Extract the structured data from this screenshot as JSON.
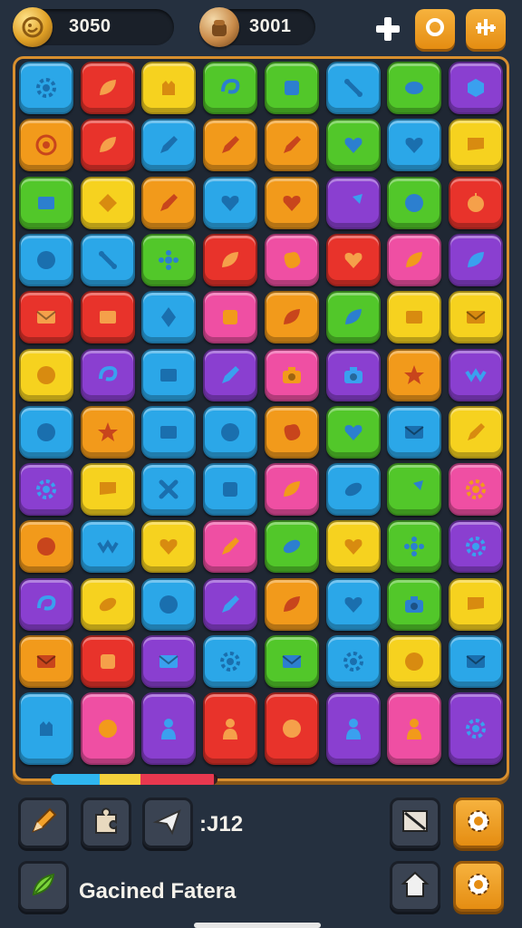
{
  "hud": {
    "coins_value": "3050",
    "bag_value": "3001",
    "add_icon": "plus-icon",
    "ring_icon": "ring-icon",
    "sound_icon": "equalizer-icon"
  },
  "board": {
    "columns": 8,
    "rows": [
      [
        {
          "c": "#2ba7e8",
          "i": "gear"
        },
        {
          "c": "#e8332b",
          "i": "leaf"
        },
        {
          "c": "#f6d21f",
          "i": "cat"
        },
        {
          "c": "#52c72a",
          "i": "swirl"
        },
        {
          "c": "#52c72a",
          "i": "box"
        },
        {
          "c": "#2ba7e8",
          "i": "bone"
        },
        {
          "c": "#52c72a",
          "i": "oval"
        },
        {
          "c": "#8a3fd0",
          "i": "hex"
        }
      ],
      [
        {
          "c": "#f29a1b",
          "i": "target"
        },
        {
          "c": "#e8332b",
          "i": "leaf"
        },
        {
          "c": "#2ba7e8",
          "i": "pencil"
        },
        {
          "c": "#f29a1b",
          "i": "pencil"
        },
        {
          "c": "#f29a1b",
          "i": "pencil"
        },
        {
          "c": "#52c72a",
          "i": "heart"
        },
        {
          "c": "#2ba7e8",
          "i": "heart"
        },
        {
          "c": "#f6d21f",
          "i": "flag"
        }
      ],
      [
        {
          "c": "#52c72a",
          "i": "square"
        },
        {
          "c": "#f6d21f",
          "i": "diamond"
        },
        {
          "c": "#f29a1b",
          "i": "pencil"
        },
        {
          "c": "#2ba7e8",
          "i": "heart"
        },
        {
          "c": "#f29a1b",
          "i": "heart"
        },
        {
          "c": "#8a3fd0",
          "i": "arrow"
        },
        {
          "c": "#52c72a",
          "i": "circle"
        },
        {
          "c": "#e8332b",
          "i": "apple"
        }
      ],
      [
        {
          "c": "#2ba7e8",
          "i": "circle"
        },
        {
          "c": "#2ba7e8",
          "i": "bone"
        },
        {
          "c": "#52c72a",
          "i": "flower"
        },
        {
          "c": "#e8332b",
          "i": "leaf"
        },
        {
          "c": "#ef4fa3",
          "i": "blob"
        },
        {
          "c": "#e8332b",
          "i": "heart"
        },
        {
          "c": "#ef4fa3",
          "i": "leaf"
        },
        {
          "c": "#8a3fd0",
          "i": "leaf"
        }
      ],
      [
        {
          "c": "#e8332b",
          "i": "mail"
        },
        {
          "c": "#e8332b",
          "i": "square"
        },
        {
          "c": "#2ba7e8",
          "i": "crystal"
        },
        {
          "c": "#ef4fa3",
          "i": "box"
        },
        {
          "c": "#f29a1b",
          "i": "leaf"
        },
        {
          "c": "#52c72a",
          "i": "leaf"
        },
        {
          "c": "#f6d21f",
          "i": "square"
        },
        {
          "c": "#f6d21f",
          "i": "mail"
        }
      ],
      [
        {
          "c": "#f6d21f",
          "i": "circle"
        },
        {
          "c": "#8a3fd0",
          "i": "swirl"
        },
        {
          "c": "#2ba7e8",
          "i": "square"
        },
        {
          "c": "#8a3fd0",
          "i": "pencil"
        },
        {
          "c": "#ef4fa3",
          "i": "camera"
        },
        {
          "c": "#8a3fd0",
          "i": "camera"
        },
        {
          "c": "#f29a1b",
          "i": "star"
        },
        {
          "c": "#8a3fd0",
          "i": "wave"
        }
      ],
      [
        {
          "c": "#2ba7e8",
          "i": "circle"
        },
        {
          "c": "#f29a1b",
          "i": "star"
        },
        {
          "c": "#2ba7e8",
          "i": "square"
        },
        {
          "c": "#2ba7e8",
          "i": "circle"
        },
        {
          "c": "#f29a1b",
          "i": "blob"
        },
        {
          "c": "#52c72a",
          "i": "heart"
        },
        {
          "c": "#2ba7e8",
          "i": "mail"
        },
        {
          "c": "#f6d21f",
          "i": "pencil"
        }
      ],
      [
        {
          "c": "#8a3fd0",
          "i": "gear"
        },
        {
          "c": "#f6d21f",
          "i": "flag"
        },
        {
          "c": "#2ba7e8",
          "i": "cross"
        },
        {
          "c": "#2ba7e8",
          "i": "box"
        },
        {
          "c": "#ef4fa3",
          "i": "leaf"
        },
        {
          "c": "#2ba7e8",
          "i": "bean"
        },
        {
          "c": "#52c72a",
          "i": "arrow"
        },
        {
          "c": "#ef4fa3",
          "i": "gear"
        }
      ],
      [
        {
          "c": "#f29a1b",
          "i": "circle"
        },
        {
          "c": "#2ba7e8",
          "i": "wave"
        },
        {
          "c": "#f6d21f",
          "i": "heart"
        },
        {
          "c": "#ef4fa3",
          "i": "pencil"
        },
        {
          "c": "#52c72a",
          "i": "bean"
        },
        {
          "c": "#f6d21f",
          "i": "heart"
        },
        {
          "c": "#52c72a",
          "i": "flower"
        },
        {
          "c": "#8a3fd0",
          "i": "gear"
        }
      ],
      [
        {
          "c": "#8a3fd0",
          "i": "swirl"
        },
        {
          "c": "#f6d21f",
          "i": "bean"
        },
        {
          "c": "#2ba7e8",
          "i": "circle"
        },
        {
          "c": "#8a3fd0",
          "i": "pencil"
        },
        {
          "c": "#f29a1b",
          "i": "leaf"
        },
        {
          "c": "#2ba7e8",
          "i": "heart"
        },
        {
          "c": "#52c72a",
          "i": "camera"
        },
        {
          "c": "#f6d21f",
          "i": "flag"
        }
      ],
      [
        {
          "c": "#f29a1b",
          "i": "mail"
        },
        {
          "c": "#e8332b",
          "i": "box"
        },
        {
          "c": "#8a3fd0",
          "i": "mail"
        },
        {
          "c": "#2ba7e8",
          "i": "gear"
        },
        {
          "c": "#52c72a",
          "i": "mail"
        },
        {
          "c": "#2ba7e8",
          "i": "gear"
        },
        {
          "c": "#f6d21f",
          "i": "circle"
        },
        {
          "c": "#2ba7e8",
          "i": "mail"
        }
      ],
      [
        {
          "c": "#2ba7e8",
          "i": "cat"
        },
        {
          "c": "#ef4fa3",
          "i": "circle"
        },
        {
          "c": "#8a3fd0",
          "i": "figure"
        },
        {
          "c": "#e8332b",
          "i": "figure"
        },
        {
          "c": "#e8332b",
          "i": "circle"
        },
        {
          "c": "#8a3fd0",
          "i": "figure"
        },
        {
          "c": "#ef4fa3",
          "i": "figure"
        },
        {
          "c": "#8a3fd0",
          "i": "gear"
        }
      ]
    ]
  },
  "progress": {
    "fraction": 0.98
  },
  "bottom": {
    "counter_text": ":J12",
    "caption_text": "Gacined Fatera",
    "pencil_tool_icon": "pencil-icon",
    "puzzle_tool_icon": "puzzle-icon",
    "plane_tool_icon": "paper-plane-icon",
    "leaf_tool_icon": "leaf-icon",
    "map_tool_icon": "map-icon",
    "settings_icon": "gear-icon",
    "home_icon": "home-icon",
    "settings2_icon": "gear-icon"
  }
}
